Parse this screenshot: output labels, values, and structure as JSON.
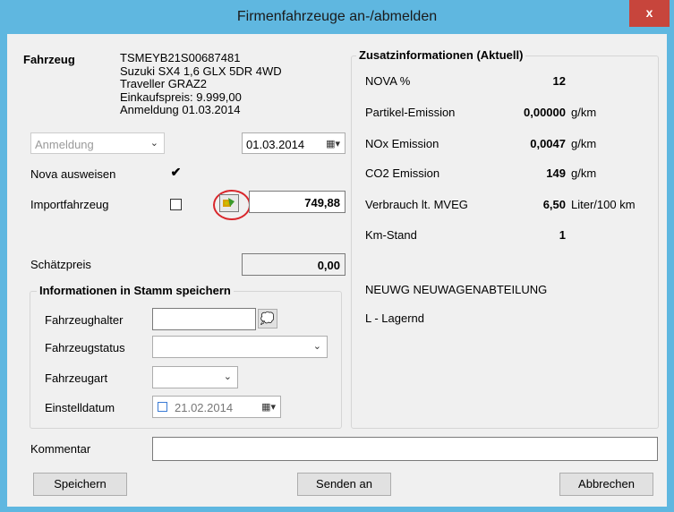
{
  "window": {
    "title": "Firmenfahrzeuge an-/abmelden",
    "close_label": "x"
  },
  "vehicle": {
    "label": "Fahrzeug",
    "lines": [
      "TSMEYB21S00687481",
      "Suzuki SX4 1,6 GLX 5DR 4WD",
      "Traveller GRAZ2",
      "Einkaufspreis: 9.999,00",
      "Anmeldung 01.03.2014"
    ]
  },
  "mode_combo": {
    "value": "Anmeldung",
    "date": "01.03.2014"
  },
  "nova": {
    "label": "Nova ausweisen",
    "checked": true,
    "check_glyph": "✔"
  },
  "import": {
    "label": "Importfahrzeug",
    "checked": false,
    "value": "749,88"
  },
  "schaetzpreis": {
    "label": "Schätzpreis",
    "value": "0,00"
  },
  "stamm": {
    "title": "Informationen in Stamm speichern",
    "fahrzeughalter_label": "Fahrzeughalter",
    "fahrzeughalter_value": "",
    "fahrzeugstatus_label": "Fahrzeugstatus",
    "fahrzeugstatus_value": "",
    "fahrzeugart_label": "Fahrzeugart",
    "fahrzeugart_value": "",
    "einstelldatum_label": "Einstelldatum",
    "einstelldatum_value": "21.02.2014"
  },
  "zusatz": {
    "title": "Zusatzinformationen (Aktuell)",
    "rows": [
      {
        "label": "NOVA %",
        "value": "12",
        "unit": ""
      },
      {
        "label": "Partikel-Emission",
        "value": "0,00000",
        "unit": "g/km"
      },
      {
        "label": "NOx Emission",
        "value": "0,0047",
        "unit": "g/km"
      },
      {
        "label": "CO2 Emission",
        "value": "149",
        "unit": "g/km"
      },
      {
        "label": "Verbrauch lt. MVEG",
        "value": "6,50",
        "unit": "Liter/100 km"
      },
      {
        "label": "Km-Stand",
        "value": "1",
        "unit": ""
      }
    ],
    "abteilung": "NEUWG NEUWAGENABTEILUNG",
    "lager": "L - Lagernd"
  },
  "kommentar": {
    "label": "Kommentar",
    "value": ""
  },
  "buttons": {
    "save": "Speichern",
    "send": "Senden an",
    "cancel": "Abbrechen"
  },
  "colors": {
    "titlebar": "#5fb7e0",
    "close": "#c7453c",
    "highlight_circle": "#d9262b"
  }
}
